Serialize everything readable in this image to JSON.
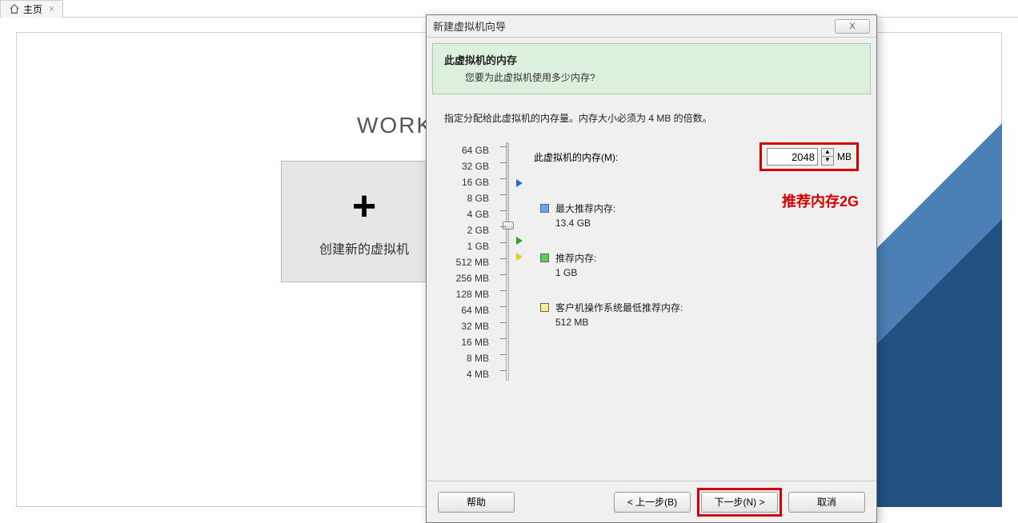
{
  "tab": {
    "label": "主页",
    "close": "×"
  },
  "bg_text": "WORK",
  "tile": {
    "label": "创建新的虚拟机"
  },
  "dialog": {
    "title": "新建虚拟机向导",
    "close": "X",
    "header_title": "此虚拟机的内存",
    "header_sub": "您要为此虚拟机使用多少内存?",
    "instruction": "指定分配给此虚拟机的内存量。内存大小必须为 4 MB 的倍数。",
    "mem_label": "此虚拟机的内存(M):",
    "mem_value": "2048",
    "mem_unit": "MB",
    "annotation": "推荐内存2G",
    "scale": [
      "64 GB",
      "32 GB",
      "16 GB",
      "8 GB",
      "4 GB",
      "2 GB",
      "1 GB",
      "512 MB",
      "256 MB",
      "128 MB",
      "64 MB",
      "32 MB",
      "16 MB",
      "8 MB",
      "4 MB"
    ],
    "legend_max_label": "最大推荐内存:",
    "legend_max_value": "13.4 GB",
    "legend_rec_label": "推荐内存:",
    "legend_rec_value": "1 GB",
    "legend_min_label": "客户机操作系统最低推荐内存:",
    "legend_min_value": "512 MB",
    "btn_help": "帮助",
    "btn_back": "< 上一步(B)",
    "btn_next": "下一步(N) >",
    "btn_cancel": "取消"
  }
}
